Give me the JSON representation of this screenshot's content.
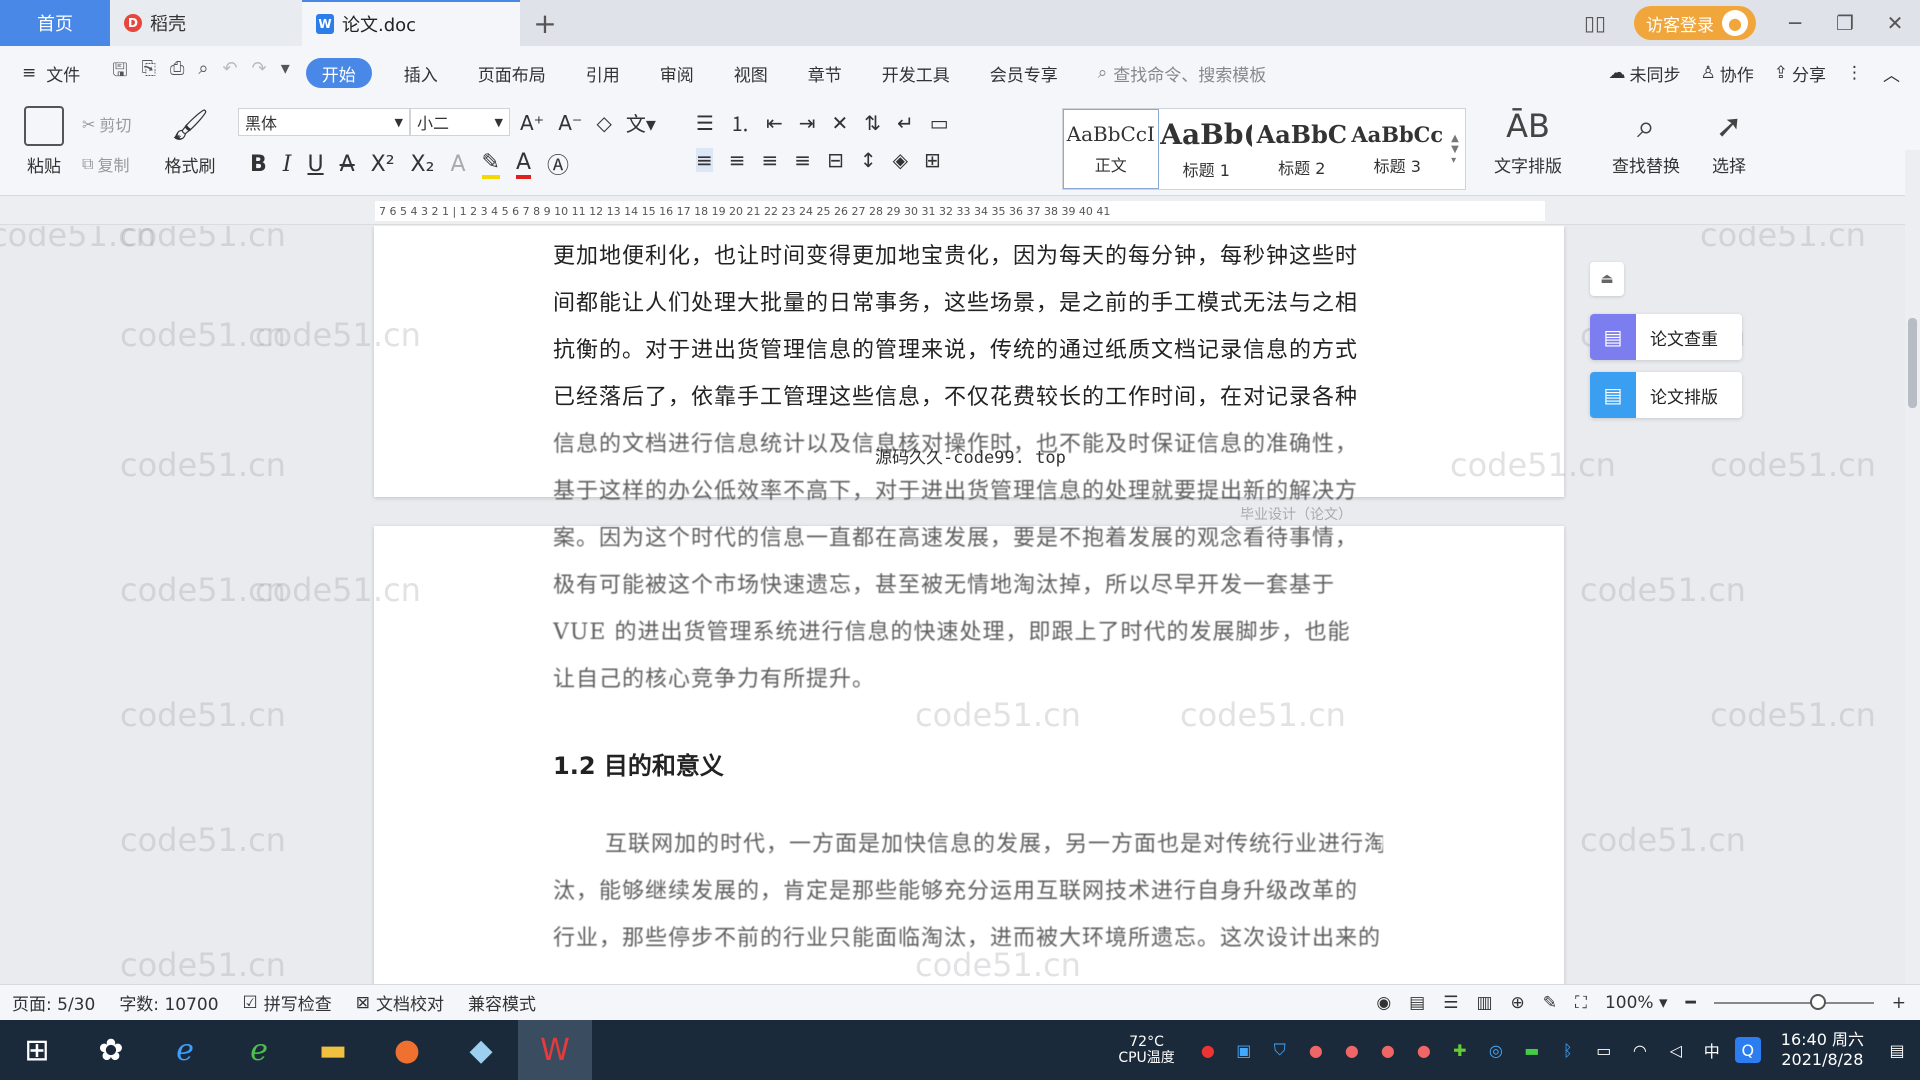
{
  "tabs": {
    "home": "首页",
    "daoke": "稻壳",
    "doc": "论文.doc"
  },
  "titlebar": {
    "login": "访客登录"
  },
  "menu": {
    "file": "文件",
    "tabs": [
      "开始",
      "插入",
      "页面布局",
      "引用",
      "审阅",
      "视图",
      "章节",
      "开发工具",
      "会员专享"
    ],
    "search_placeholder": "查找命令、搜索模板",
    "unsync": "未同步",
    "collab": "协作",
    "share": "分享"
  },
  "ribbon": {
    "paste": "粘贴",
    "cut": "剪切",
    "copy": "复制",
    "format_painter": "格式刷",
    "font_name": "黑体",
    "font_size": "小二",
    "styles": [
      {
        "preview": "AaBbCcI",
        "name": "正文"
      },
      {
        "preview": "AaBb(",
        "name": "标题 1"
      },
      {
        "preview": "AaBbC",
        "name": "标题 2"
      },
      {
        "preview": "AaBbCcl",
        "name": "标题 3"
      }
    ],
    "text_layout": "文字排版",
    "find_replace": "查找替换",
    "select": "选择"
  },
  "ruler": {
    "ticks": "7 6 5 4 3 2 1 | 1 2 3 4 5 6 7 8 9 10 11 12 13 14 15 16 17 18 19 20 21 22 23 24 25 26 27 28 29 30 31 32 33 34 35 36 37 38 39 40 41"
  },
  "document": {
    "page1_lines": [
      "更加地便利化，也让时间变得更加地宝贵化，因为每天的每分钟，每秒钟这些时",
      "间都能让人们处理大批量的日常事务，这些场景，是之前的手工模式无法与之相",
      "抗衡的。对于进出货管理信息的管理来说，传统的通过纸质文档记录信息的方式",
      "已经落后了，依靠手工管理这些信息，不仅花费较长的工作时间，在对记录各种",
      "信息的文档进行信息统计以及信息核对操作时，也不能及时保证信息的准确性，",
      "基于这样的办公低效率不高下，对于进出货管理信息的处理就要提出新的解决方"
    ],
    "page2_lines": [
      "案。因为这个时代的信息一直都在高速发展，要是不抱着发展的观念看待事情，",
      "极有可能被这个市场快速遗忘，甚至被无情地淘汰掉，所以尽早开发一套基于",
      "VUE 的进出货管理系统进行信息的快速处理，即跟上了时代的发展脚步，也能",
      "让自己的核心竞争力有所提升。"
    ],
    "heading": "1.2 目的和意义",
    "page2b_lines": [
      "互联网加的时代，一方面是加快信息的发展，另一方面也是对传统行业进行淘",
      "汰，能够继续发展的，肯定是那些能够充分运用互联网技术进行自身升级改革的",
      "行业，那些停步不前的行业只能面临淘汰，进而被大环境所遗忘。这次设计出来的"
    ],
    "watermark": "code51.cn",
    "center_watermark": "源码久久-code99. top",
    "footer_hint": "毕业设计（论文）"
  },
  "side_panel": {
    "check": "论文查重",
    "layout": "论文排版"
  },
  "status": {
    "page": "页面: 5/30",
    "words": "字数: 10700",
    "spell": "拼写检查",
    "proof": "文档校对",
    "compat": "兼容模式",
    "zoom": "100%",
    "zoom_level": 1.0
  },
  "taskbar": {
    "temperature": "72°C",
    "cpu_label": "CPU温度",
    "ime": "中",
    "time": "16:40 周六",
    "date": "2021/8/28"
  },
  "colors": {
    "accent": "#4a88e8",
    "login": "#f1a63b",
    "taskbar": "#1b2a3a"
  }
}
